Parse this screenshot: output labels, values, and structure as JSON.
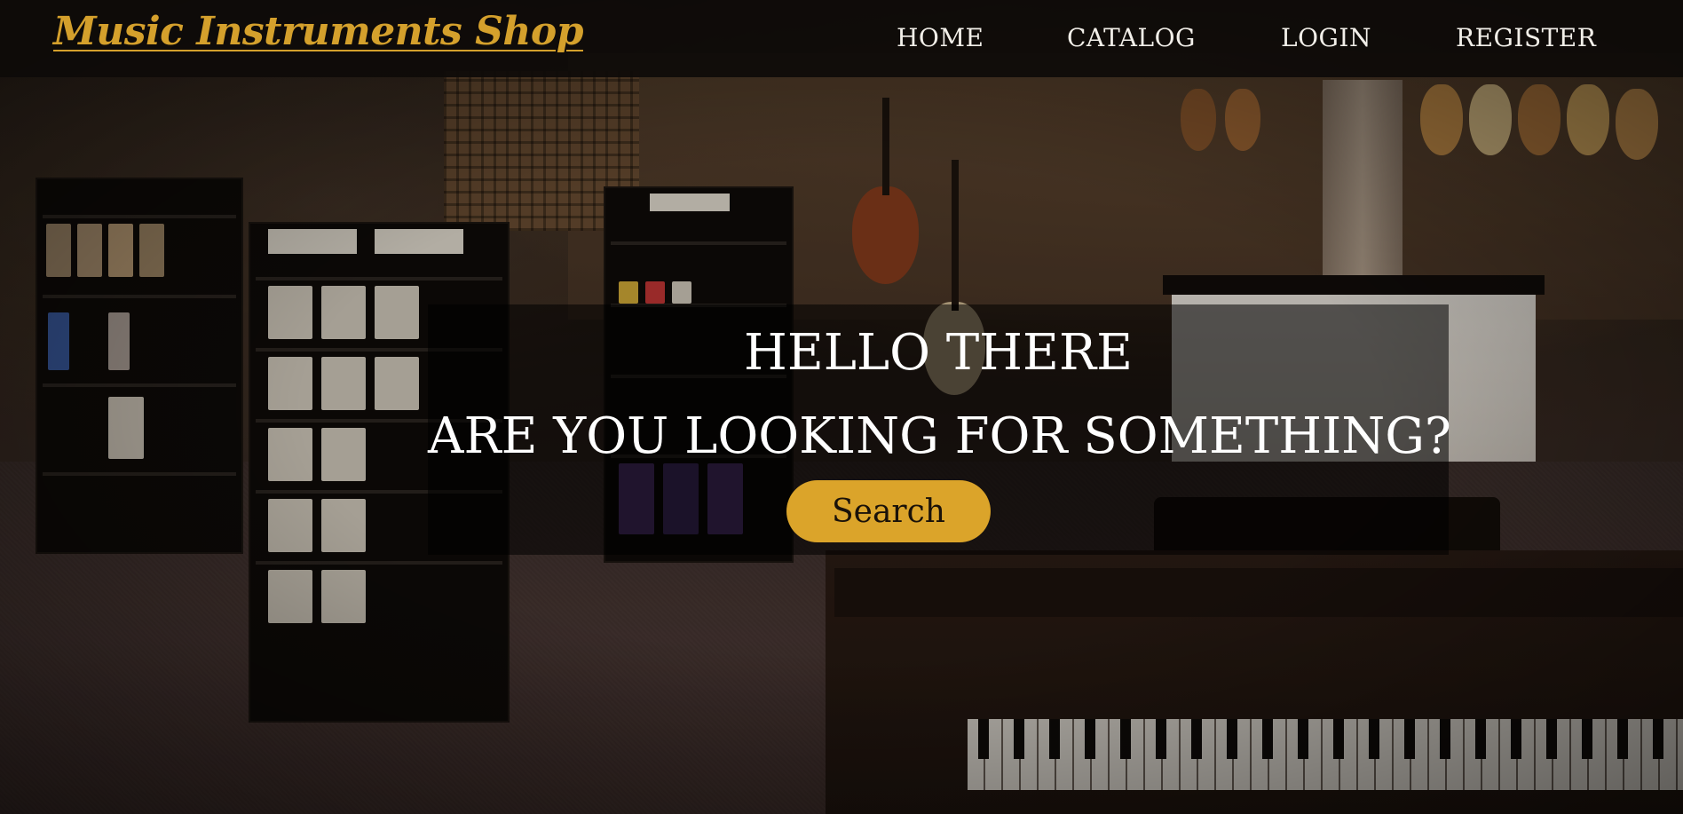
{
  "navbar": {
    "brand": "Music Instruments Shop",
    "links": [
      {
        "label": "HOME"
      },
      {
        "label": "CATALOG"
      },
      {
        "label": "LOGIN"
      },
      {
        "label": "REGISTER"
      }
    ]
  },
  "hero": {
    "title": "HELLO THERE",
    "subtitle": "ARE YOU LOOKING FOR SOMETHING?",
    "button_label": "Search"
  },
  "colors": {
    "accent": "#dba42a",
    "brand_text": "#d4a02c",
    "navbar_bg": "#0e0b09",
    "text_light": "#ffffff"
  },
  "background_image": {
    "description_icon": "music-store-photo"
  }
}
